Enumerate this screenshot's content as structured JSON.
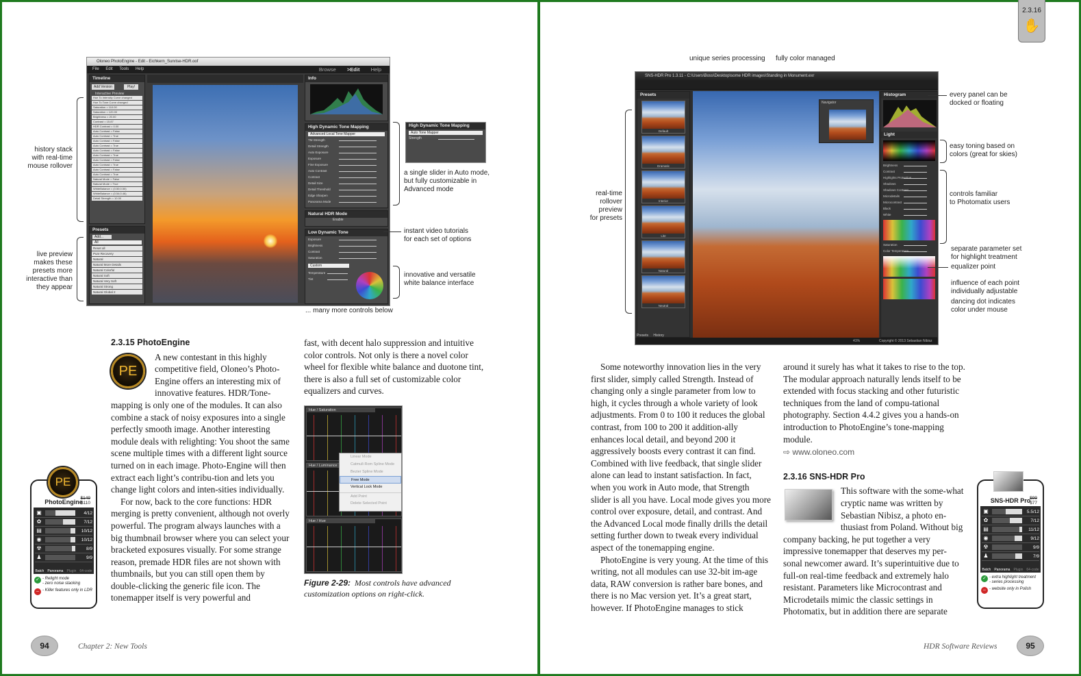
{
  "left_page": {
    "page_number": "94",
    "running_head": "Chapter 2: New Tools",
    "screenshot": {
      "title": "Oloneo PhotoEngine - Edit - Eichkern_Sunrise-HDR.oof",
      "menu": [
        "File",
        "Edit",
        "Tools",
        "Help"
      ],
      "modes": [
        "Browse",
        ">Edit",
        "Help"
      ],
      "timeline_label": "Timeline",
      "add_version": "Add Version",
      "play": "Play!",
      "interactive_preview": "Interactive Preview",
      "presets_label": "Presets",
      "add": "Add...",
      "all": "All",
      "info_label": "Info",
      "hdr_tone_mapping": "High Dynamic Tone Mapping",
      "advanced_mapper": "Advanced Local Tone Mapper",
      "natural_hdr": "Natural HDR Mode",
      "enable": "Enable",
      "low_dynamic_tone": "Low Dynamic Tone",
      "custom": "Custom",
      "popout_title": "High Dynamic Tone Mapping",
      "popout_mapper": "Auto Tone Mapper",
      "popout_strength": "Strength",
      "history": [
        "Hue To Intensity Curve changed",
        "Hue To Tone Curve changed",
        "Saturation = 110.00",
        "Saturation = 120.00",
        "Brightness = 20.00",
        "Contrast = 15.87",
        "HDR Contrast = 0.00",
        "Auto Contrast = False",
        "Auto Contrast = True",
        "Auto Contrast = False",
        "Auto Contrast = True",
        "Auto Contrast = False",
        "Auto Contrast = True",
        "Auto Contrast = False",
        "Auto Contrast = True",
        "Auto Contrast = False",
        "Auto Contrast = True",
        "Natural Mode = False",
        "Natural Mode = True",
        "WhiteBalance = (0.50;0.50)",
        "WhiteBalance = (0.54;0.46)",
        "Detail Strength = 10.00"
      ],
      "presets": [
        "Reset all",
        "Pure Recovery",
        "Natural",
        "Natural More Details",
        "Natural Colorful",
        "Natural Soft",
        "Natural Very Soft",
        "Natural Strong",
        "Natural Global 2"
      ],
      "hdr_controls": [
        "TM Strength",
        "Detail Strength",
        "Auto Exposure",
        "Exposure",
        "Fine Exposure",
        "Auto Contrast",
        "Contrast",
        "Detail Size",
        "Detail Threshold",
        "Edge Sharpen",
        "Panorama Mode"
      ],
      "ldt_controls": [
        "Exposure",
        "Brightness",
        "Contrast",
        "Saturation"
      ],
      "wb_controls": [
        "Temperature",
        "Tint"
      ]
    },
    "annotations": {
      "history": "history stack\nwith real-time\nmouse rollover",
      "live_preview": "live preview\nmakes these\npresets more\ninteractive than\nthey appear",
      "single_slider": "a single slider in Auto mode,\nbut fully customizable in\nAdvanced mode",
      "video": "instant video tutorials\nfor each set of options",
      "white_balance": "innovative and versatile\nwhite balance interface",
      "more": "... many more controls below"
    },
    "heading": "2.3.15 PhotoEngine",
    "logo": "PE",
    "col1_p1": "A new contestant in this highly competitive field, Oloneo’s Photo-Engine offers an interesting mix of innovative features. HDR/Tone-mapping is only one of the modules. It can also combine a stack of noisy exposures into a single perfectly smooth image. Another interesting module deals with relighting: You shoot the same scene multiple times with a different light source turned on in each image. Photo-Engine will then extract each light’s contribu-tion and lets you change light colors and inten-sities individually.",
    "col1_p2": "For now, back to the core functions: HDR merging is pretty convenient, although not overly powerful. The program always launches with a big thumbnail browser where you can select your bracketed exposures visually. For some strange reason, premade HDR files are not shown with thumbnails, but you can still open them by double-clicking the generic file icon. The tonemapper itself is very powerful and",
    "col2_p1": "fast, with decent halo suppression and intuitive color controls. Not only is there a novel color wheel for flexible white balance and duotone tint, there is also a full set of customizable color equalizers and curves.",
    "figure": {
      "panels": [
        "Hue / Saturation",
        "Hue / Luminance",
        "Hue / Hue"
      ],
      "menu": [
        "Linear Mode",
        "Catmull-Rom Spline Mode",
        "Bezier Spline Mode",
        "Free Mode",
        "Vertical Lock Mode",
        "Add Point",
        "Delete Selected Point"
      ],
      "selected": "Free Mode",
      "caption_label": "Figure 2-29:",
      "caption_text": "Most controls have advanced customization options on right-click."
    },
    "rating": {
      "name": "PhotoEngine",
      "old_price": "$149",
      "price": "$110",
      "rows": [
        {
          "icon": "▣",
          "value": "4/12",
          "fill": 0.33
        },
        {
          "icon": "✿",
          "value": "7/12",
          "fill": 0.58
        },
        {
          "icon": "▤",
          "value": "10/12",
          "fill": 0.83
        },
        {
          "icon": "◉",
          "value": "10/12",
          "fill": 0.83
        },
        {
          "icon": "☢",
          "value": "8/9",
          "fill": 0.89
        },
        {
          "icon": "♟",
          "value": "9/9",
          "fill": 1.0
        }
      ],
      "modes": [
        "Batch",
        "Panorama",
        "Plugin",
        "64-code"
      ],
      "pro": "- Relight mode\n- zero noise stacking",
      "con": "- Killer features only in LDR"
    }
  },
  "right_page": {
    "page_number": "95",
    "running_head": "HDR Software Reviews",
    "section_tab": "2.3.16",
    "screenshot": {
      "title": "SNS-HDR Pro 1.3.11 - C:\\Users\\Boss\\Desktop\\some HDR images\\Standing in Monument.exr",
      "presets_label": "Presets",
      "navigator": "Navigator",
      "histogram": "Histogram",
      "light": "Light",
      "zoom": "41%",
      "copyright": "Copyright © 2013 Sebastian Nibisz",
      "presets": [
        "Default",
        "Dramatic",
        "Interior",
        "Lite",
        "Natural",
        "Neutral"
      ],
      "tabs": [
        "Presets",
        "History"
      ],
      "sliders": [
        "Brightness",
        "Contrast",
        "Highlights Protection",
        "Shadows",
        "Shadows Contrast",
        "Microdetails",
        "Microcontrast",
        "Black",
        "White",
        "Saturation",
        "Color Temperature"
      ]
    },
    "annotations": {
      "series": "unique series processing",
      "color": "fully color managed",
      "dock": "every panel can be\ndocked or floating",
      "toning": "easy toning based on\ncolors (great for skies)",
      "familiar": "controls familiar\nto Photomatix users",
      "rollover": "real-time\nrollover\npreview\nfor presets",
      "separate": "separate parameter set\nfor highlight treatment",
      "equalizer": "equalizer point",
      "influence": "influence of each point\nindividually adjustable",
      "dot": "dancing dot indicates\ncolor under mouse"
    },
    "col1_p1": "Some noteworthy innovation lies in the very first slider, simply called Strength. Instead of changing only a single parameter from low to high, it cycles through a whole variety of look adjustments. From 0 to 100 it reduces the global contrast, from 100 to 200 it addition-ally enhances local detail, and beyond 200 it aggressively boosts every contrast it can find. Combined with live feedback, that single slider alone can lead to instant satisfaction. In fact, when you work in Auto mode, that Strength slider is all you have. Local mode gives you more control over exposure, detail, and contrast. And the Advanced Local mode finally drills the detail setting further down to tweak every individual aspect of the tonemapping engine.",
    "col1_p2": "PhotoEngine is very young. At the time of this writing, not all modules can use 32-bit im-age data, RAW conversion is rather bare bones, and there is no Mac version yet. It’s a great start, however. If PhotoEngine manages to stick",
    "col2_p1": "around it surely has what it takes to rise to the top. The modular approach naturally lends itself to be extended with focus stacking and other futuristic techniques from the land of compu-tational photography. Section 4.4.2 gives you a hands-on introduction to PhotoEngine’s tone-mapping module.",
    "url": "www.oloneo.com",
    "heading": "2.3.16 SNS-HDR Pro",
    "col2_p2": "This software with the some-what cryptic name was written by Sebastian Nibisz, a photo en-thusiast from Poland. Without big company backing, he put together a very impressive tonemapper that deserves my per-sonal newcomer award. It’s superintuitive due to full-on real-time feedback and extremely halo resistant. Parameters like Microcontrast and Microdetails mimic the classic settings in Photomatix, but in addition there are separate",
    "rating": {
      "name": "SNS-HDR Pro",
      "old_price": "$99",
      "price": "$77",
      "rows": [
        {
          "icon": "▣",
          "value": "5.5/12",
          "fill": 0.46
        },
        {
          "icon": "✿",
          "value": "7/12",
          "fill": 0.58
        },
        {
          "icon": "▤",
          "value": "11/12",
          "fill": 0.92
        },
        {
          "icon": "◉",
          "value": "9/12",
          "fill": 0.75
        },
        {
          "icon": "☢",
          "value": "9/9",
          "fill": 1.0
        },
        {
          "icon": "♟",
          "value": "7/9",
          "fill": 0.78
        }
      ],
      "modes": [
        "Batch",
        "Panorama",
        "Plugin",
        "64-code"
      ],
      "pro": "- extra highlight treatment\n- series processing",
      "con": "- website only in Polish"
    }
  },
  "colors": {
    "frame": "#1f7a1f",
    "folio": "#bdbdbd",
    "accent_gold": "#b98a24"
  }
}
